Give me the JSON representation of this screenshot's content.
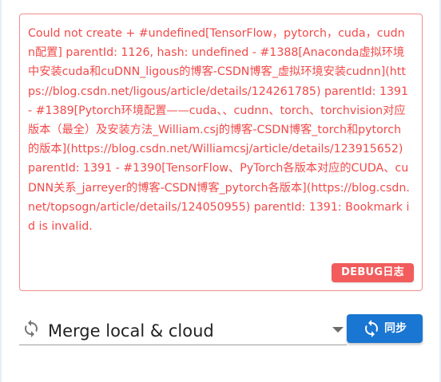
{
  "error_panel": {
    "message": "Could not create + #undefined[TensorFlow，pytorch，cuda，cudnn配置] parentId: 1126, hash: undefined - #1388[Anaconda虚拟环境中安装cuda和cuDNN_ligous的博客-CSDN博客_虚拟环境安装cudnn](https://blog.csdn.net/ligous/article/details/124261785) parentId: 1391 - #1389[Pytorch环境配置——cuda、、cudnn、torch、torchvision对应版本（最全）及安装方法_William.csj的博客-CSDN博客_torch和pytorch的版本](https://blog.csdn.net/Williamcsj/article/details/123915652) parentId: 1391 - #1390[TensorFlow、PyTorch各版本对应的CUDA、cuDNN关系_jarreyer的博客-CSDN博客_pytorch各版本](https://blog.csdn.net/topsogn/article/details/124050955) parentId: 1391: Bookmark id is invalid.",
    "debug_button_label": "DEBUG日志",
    "colors": {
      "text": "#f24a4a",
      "border": "#f28b8b",
      "debug_button_bg": "#f25c5c"
    }
  },
  "sync": {
    "mode_select": {
      "selected_value": "Merge local & cloud",
      "icon": "sync-icon"
    },
    "sync_button": {
      "label": "同步",
      "icon": "sync-icon",
      "color": "#1976d2"
    }
  }
}
